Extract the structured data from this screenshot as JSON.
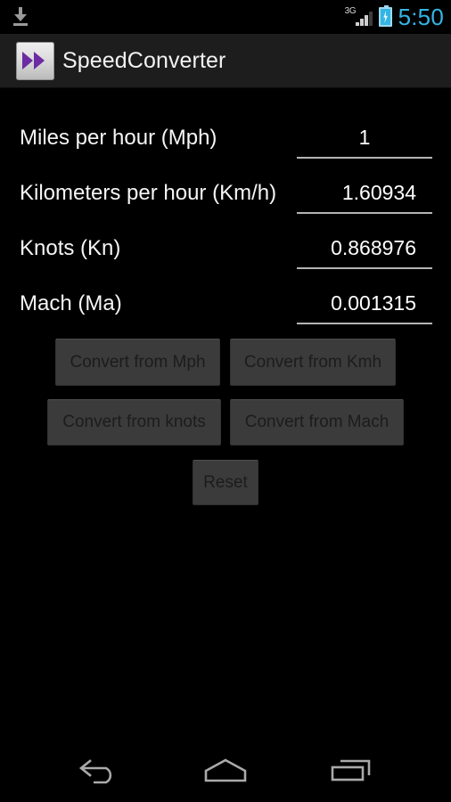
{
  "status_bar": {
    "download_icon": "download-icon",
    "network_type": "3G",
    "signal_icon": "signal-bars-icon",
    "battery_icon": "battery-charging-icon",
    "time": "5:50",
    "time_color": "#33b5e5"
  },
  "action_bar": {
    "app_icon": "fast-forward-icon",
    "icon_color": "#6c2ba3",
    "title": "SpeedConverter",
    "background": "#1d1d1d"
  },
  "converter": {
    "rows": [
      {
        "label": "Miles per hour (Mph)",
        "value": "1",
        "field_name": "mph-input"
      },
      {
        "label": "Kilometers per hour (Km/h)",
        "value": "1.60934",
        "field_name": "kmh-input"
      },
      {
        "label": "Knots (Kn)",
        "value": "0.868976",
        "field_name": "knots-input"
      },
      {
        "label": "Mach (Ma)",
        "value": "0.001315",
        "field_name": "mach-input"
      }
    ],
    "buttons": {
      "convert_from_mph": "Convert from Mph",
      "convert_from_kmh": "Convert from Kmh",
      "convert_from_knots": "Convert from knots",
      "convert_from_mach": "Convert from Mach",
      "reset": "Reset"
    },
    "button_background": "#3b3b3b",
    "button_text_color": "#1c1c1c"
  },
  "nav_bar": {
    "back": "back-icon",
    "home": "home-icon",
    "recents": "recent-apps-icon"
  }
}
